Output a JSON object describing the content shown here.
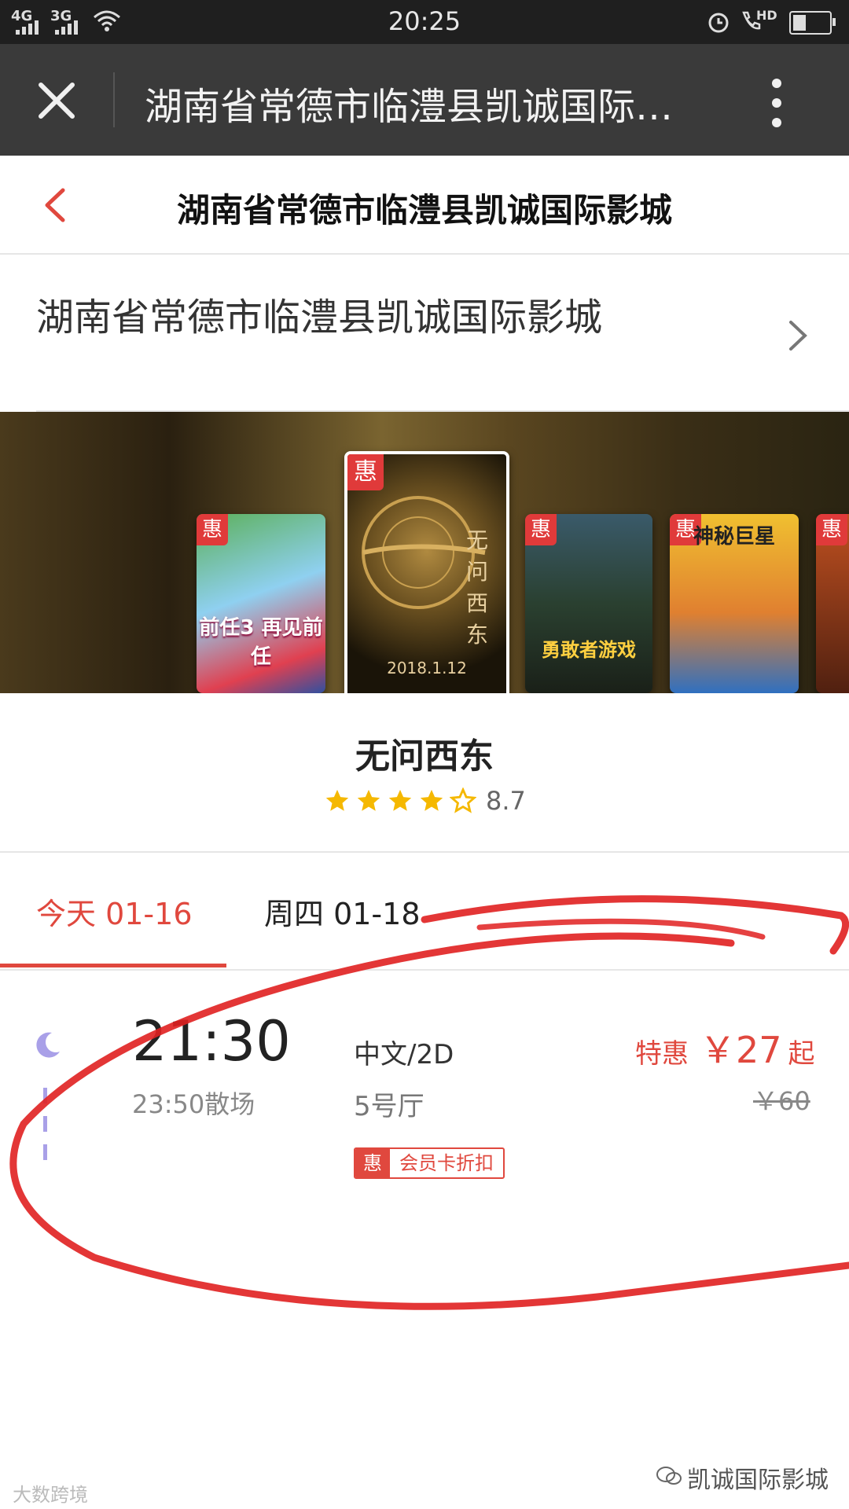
{
  "status_bar": {
    "time": "20:25",
    "net1": "4G",
    "net2": "3G",
    "hd": "HD"
  },
  "titlebar": {
    "title": "湖南省常德市临澧县凯诚国际影城"
  },
  "header": {
    "title": "湖南省常德市临澧县凯诚国际影城"
  },
  "cinema": {
    "name": "湖南省常德市临澧县凯诚国际影城"
  },
  "posters": [
    {
      "badge": "惠",
      "caption": "前任3 再见前任"
    },
    {
      "badge": "惠",
      "caption": "无问西东",
      "date": "2018.1.12"
    },
    {
      "badge": "惠",
      "caption": "勇敢者游戏"
    },
    {
      "badge": "惠",
      "caption": "神秘巨星"
    },
    {
      "badge": "惠"
    }
  ],
  "movie": {
    "title": "无问西东",
    "rating": 8.7,
    "rating_text": "8.7",
    "stars_filled": 4,
    "stars_total": 5
  },
  "tabs": [
    {
      "label": "今天 01-16",
      "active": true
    },
    {
      "label": "周四 01-18",
      "active": false
    }
  ],
  "showtime": {
    "start": "21:30",
    "end": "23:50散场",
    "language": "中文/2D",
    "hall": "5号厅",
    "promo_tag": "惠",
    "promo_label": "会员卡折扣",
    "price_label": "特惠",
    "price": "￥27",
    "price_suffix": "起",
    "original_price": "￥60"
  },
  "watermarks": {
    "left": "大数跨境",
    "right": "凯诚国际影城"
  },
  "colors": {
    "accent": "#e0483e",
    "star": "#f5b800",
    "moon": "#a9a0e8"
  }
}
